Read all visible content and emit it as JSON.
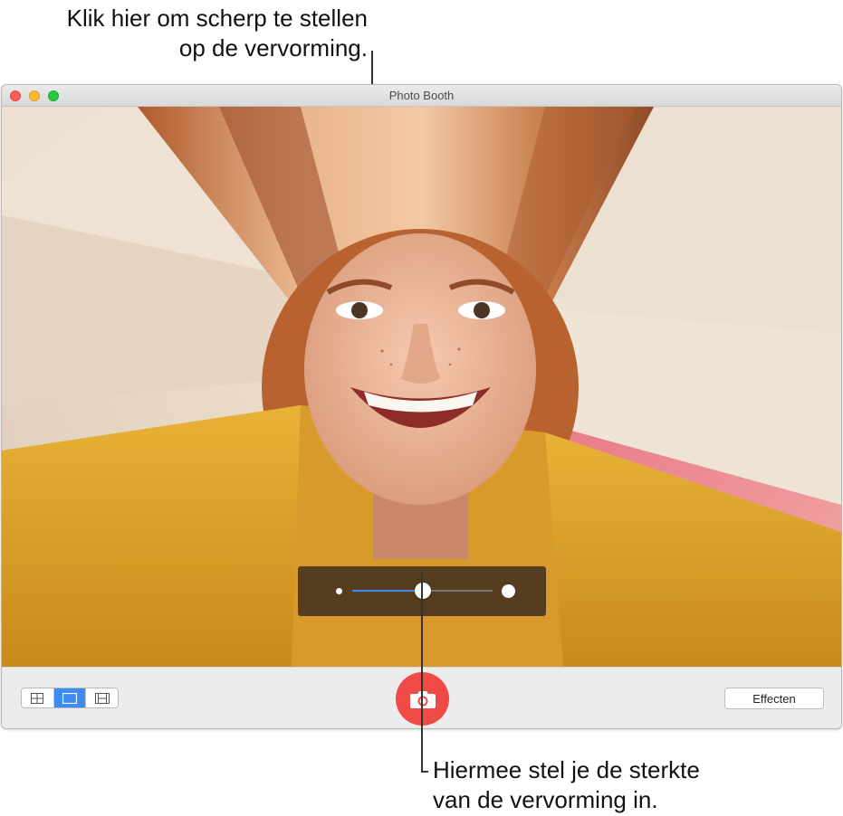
{
  "callouts": {
    "top_line1": "Klik hier om scherp te stellen",
    "top_line2": "op de vervorming.",
    "bottom_line1": "Hiermee stel je de sterkte",
    "bottom_line2": "van de vervorming in."
  },
  "window": {
    "title": "Photo Booth"
  },
  "viewport": {
    "image": "distorted-portrait-photo"
  },
  "distortion_slider": {
    "value": 0.5
  },
  "toolbar": {
    "view_modes": [
      {
        "icon": "grid-four-icon",
        "selected": false
      },
      {
        "icon": "single-frame-icon",
        "selected": true
      },
      {
        "icon": "filmstrip-icon",
        "selected": false
      }
    ],
    "shutter_icon": "camera-icon",
    "effects_label": "Effecten"
  },
  "colors": {
    "accent": "#3c8cf2",
    "shutter": "#f04a46"
  }
}
